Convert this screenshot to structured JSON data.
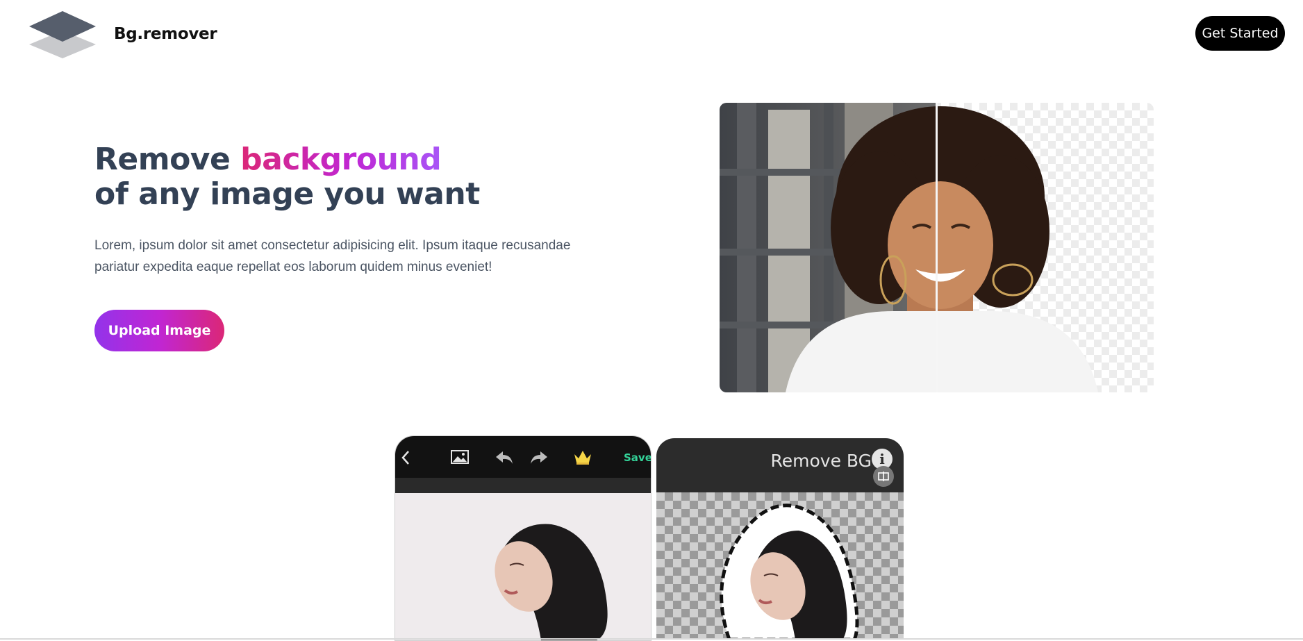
{
  "header": {
    "brand": "Bg.remover",
    "cta_label": "Get Started"
  },
  "hero": {
    "title_part1": "Remove ",
    "title_highlight": "background",
    "title_line2": "of any image you want",
    "description": "Lorem, ipsum dolor sit amet consectetur adipisicing elit. Ipsum itaque recusandae pariatur expedita eaque repellat eos laborum quidem minus eveniet!",
    "upload_label": "Upload Image"
  },
  "phone_left": {
    "save_label": "Save",
    "icons": [
      "back-chevron-icon",
      "image-icon",
      "undo-icon",
      "redo-icon",
      "crown-icon"
    ]
  },
  "phone_right": {
    "title": "Remove BG",
    "info_glyph": "i",
    "icons": [
      "info-icon",
      "compare-icon"
    ]
  },
  "colors": {
    "accent_gradient_start": "#db2777",
    "accent_gradient_end": "#a855f7",
    "upload_gradient_start": "#9333ea",
    "upload_gradient_end": "#db2777",
    "heading": "#334155",
    "save_green": "#34d399"
  }
}
